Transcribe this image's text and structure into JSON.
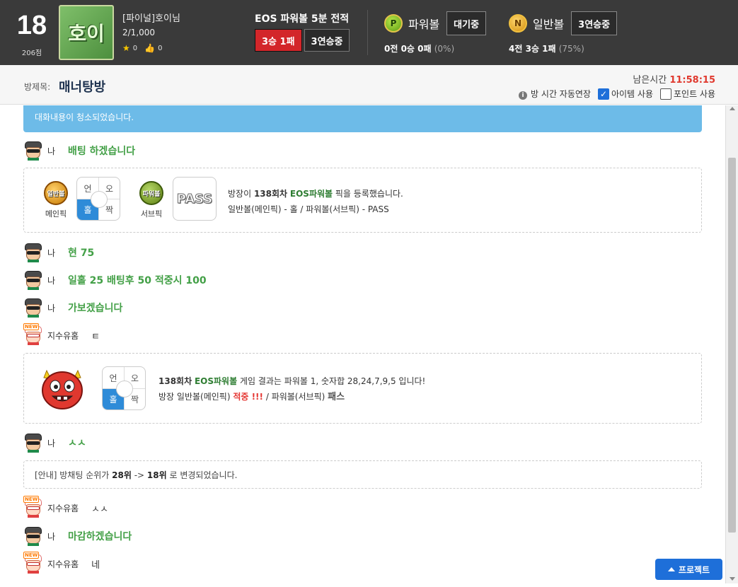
{
  "header": {
    "rank": "18",
    "points": "206점",
    "avatar_text": "호이",
    "nickname": "[파이널]호이님",
    "count": "2/1,000",
    "stars": "0",
    "likes": "0",
    "eos_title": "EOS 파워볼 5분 전적",
    "eos_record": "3승 1패",
    "eos_streak": "3연승중",
    "powerball": {
      "icon_letter": "P",
      "name": "파워볼",
      "status": "대기중",
      "record": "0전 0승 0패",
      "pct": "(0%)"
    },
    "generalball": {
      "icon_letter": "N",
      "name": "일반볼",
      "status": "3연승중",
      "record": "4전 3승 1패",
      "pct": "(75%)"
    }
  },
  "room": {
    "label": "방제목:",
    "title": "매너탕방",
    "time_label": "남은시간",
    "time_value": "11:58:15",
    "auto_extend": "방 시간 자동연장",
    "item_use": "아이템 사용",
    "point_use": "포인트 사용",
    "item_checked": true,
    "point_checked": false
  },
  "chat": {
    "cleared_notice": "대화내용이 청소되었습니다.",
    "messages": [
      {
        "who": "나",
        "text": "배팅 하겠습니다"
      },
      {
        "who": "나",
        "text": "현 75"
      },
      {
        "who": "나",
        "text": "일홀 25 배팅후 50 적중시 100"
      },
      {
        "who": "나",
        "text": "가보겠습니다"
      },
      {
        "who": "지수유홈",
        "text": "ㅌ"
      },
      {
        "who": "나",
        "text": "ㅅㅅ"
      },
      {
        "who": "지수유홈",
        "text": "ㅅㅅ"
      },
      {
        "who": "나",
        "text": "마감하겠습니다"
      },
      {
        "who": "지수유홈",
        "text": "네"
      }
    ],
    "new_tag": "NEW",
    "pick": {
      "main_ball": "일반볼",
      "main_caption": "메인픽",
      "sub_ball": "파워볼",
      "sub_caption": "서브픽",
      "grid": {
        "tl": "언",
        "tr": "오",
        "bl": "홀",
        "br": "짝"
      },
      "pass": "PASS",
      "line1_pre": "방장이 ",
      "line1_round": "138회차",
      "line1_game": "EOS파워볼",
      "line1_post": " 픽을 등록했습니다.",
      "line2": "일반볼(메인픽) - 홀 / 파워볼(서브픽) - PASS"
    },
    "result": {
      "grid": {
        "tl": "언",
        "tr": "오",
        "bl": "홀",
        "br": "짝"
      },
      "line1_round": "138회차",
      "line1_game": "EOS파워볼",
      "line1_post": " 게임 결과는 파워볼 1, 숫자합 28,24,7,9,5 입니다!",
      "line2_pre": "방장 일반볼(메인픽) ",
      "line2_hit": "적중 !!!",
      "line2_mid": " / 파워볼(서브픽) ",
      "line2_pass": "패스"
    },
    "info": {
      "pre": "[안내] 방채팅 순위가 ",
      "from": "28위",
      "arrow": " -> ",
      "to": "18위",
      "post": " 로 변경되었습니다."
    }
  },
  "project_button": "프로젝트"
}
